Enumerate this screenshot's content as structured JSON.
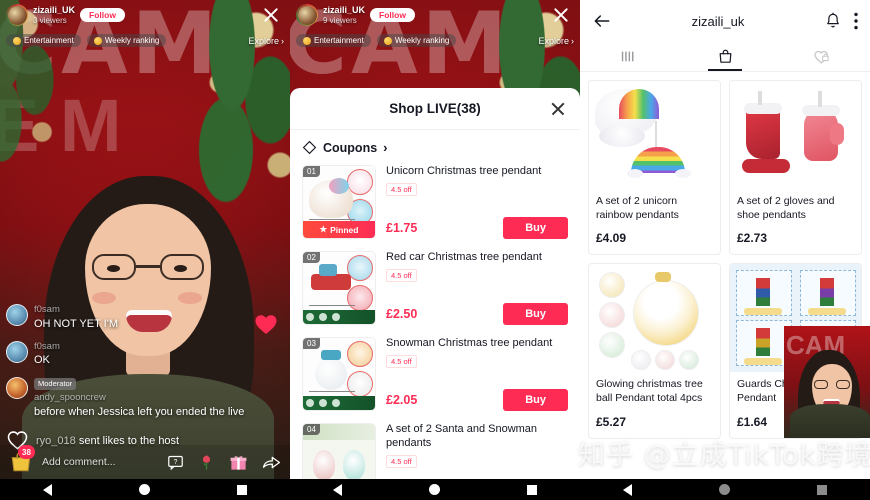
{
  "live": {
    "username": "zizaili_UK",
    "viewers_left": "3 viewers",
    "viewers_middle": "9 viewers",
    "follow_label": "Follow",
    "tag_entertainment": "Entertainment",
    "tag_weekly": "Weekly ranking",
    "explore_label": "Explore",
    "explore_chevron": "›",
    "backdrop_text": "CAM",
    "backdrop_text2": "E M",
    "chat": [
      {
        "name": "f0sam",
        "text": "OH NOT YET I'M",
        "badge": ""
      },
      {
        "name": "f0sam",
        "text": "OK",
        "badge": ""
      },
      {
        "name": "andy_spooncrew",
        "text": "before when Jessica left you ended the live",
        "badge": "Moderator"
      }
    ],
    "like_event_user": "ryo_018",
    "like_event_text": "sent likes to the host",
    "bottom_bar": {
      "bag_badge": "38",
      "comment_placeholder": "Add comment...",
      "icons": [
        "question-box-icon",
        "rose-icon",
        "gift-icon",
        "share-icon"
      ]
    }
  },
  "shop_sheet": {
    "title": "Shop LIVE(38)",
    "close_icon": "close-icon",
    "coupons_label": "Coupons",
    "coupons_chevron": "›",
    "buy_label": "Buy",
    "pinned_label": "Pinned",
    "products": [
      {
        "rank": "01",
        "name": "Unicorn Christmas tree pendant",
        "off": "4.5 off",
        "price": "£1.75",
        "pinned": true
      },
      {
        "rank": "02",
        "name": "Red car Christmas tree pendant",
        "off": "4.5 off",
        "price": "£2.50",
        "pinned": false
      },
      {
        "rank": "03",
        "name": "Snowman Christmas tree pendant",
        "off": "4.5 off",
        "price": "£2.05",
        "pinned": false
      },
      {
        "rank": "04",
        "name": "A set of 2 Santa and Snowman pendants",
        "off": "4.5 off",
        "price": "",
        "pinned": false
      }
    ]
  },
  "profile": {
    "title": "zizaili_uk",
    "back_icon": "back-arrow-icon",
    "bell_icon": "bell-icon",
    "more_icon": "more-vertical-icon",
    "tabs": [
      {
        "name": "videos-tab",
        "icon": "grid-icon",
        "active": false
      },
      {
        "name": "shop-tab",
        "icon": "shopping-bag-icon",
        "active": true
      },
      {
        "name": "liked-tab",
        "icon": "heart-lock-icon",
        "active": false
      }
    ],
    "products": [
      {
        "name": "A set of 2 unicorn rainbow pendants",
        "price": "£4.09"
      },
      {
        "name": "A set of 2 gloves and shoe pendants",
        "price": "£2.73"
      },
      {
        "name": "Glowing christmas tree ball Pendant total 4pcs",
        "price": "£5.27"
      },
      {
        "name": "Guards Christmas Pendant",
        "price": "£1.64"
      }
    ]
  },
  "watermark": "知乎 @立成TikTok跨境",
  "nav": {
    "back": "nav-back",
    "home": "nav-home",
    "recents": "nav-recents"
  }
}
